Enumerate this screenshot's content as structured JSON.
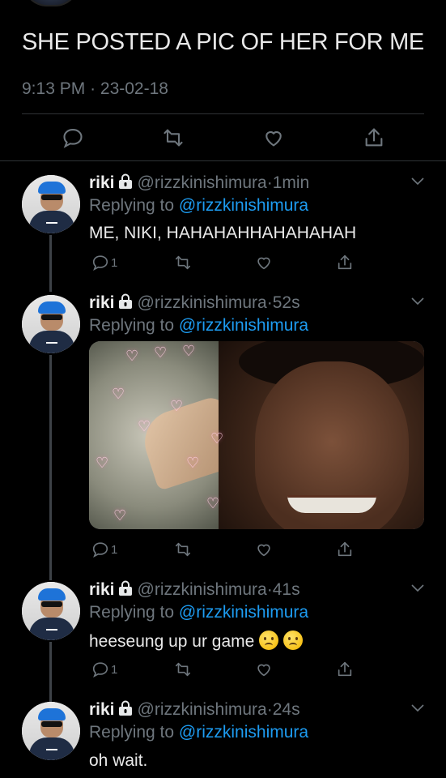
{
  "main_tweet": {
    "text": "SHE POSTED A PIC OF HER FOR ME",
    "time": "9:13 PM",
    "separator": "·",
    "date": "23-02-18"
  },
  "replies": [
    {
      "name": "riki",
      "handle": "@rizzkinishimura",
      "separator": "·",
      "time": "1min",
      "replying_prefix": "Replying to",
      "replying_to": "@rizzkinishimura",
      "text": "ME, NIKI, HAHAHAHHAHAHAHAH",
      "reply_count": "1"
    },
    {
      "name": "riki",
      "handle": "@rizzkinishimura",
      "separator": "·",
      "time": "52s",
      "replying_prefix": "Replying to",
      "replying_to": "@rizzkinishimura",
      "has_image": true,
      "reply_count": "1"
    },
    {
      "name": "riki",
      "handle": "@rizzkinishimura",
      "separator": "·",
      "time": "41s",
      "replying_prefix": "Replying to",
      "replying_to": "@rizzkinishimura",
      "text": "heeseung up ur game",
      "emojis": [
        "confused-face",
        "confused-face"
      ],
      "reply_count": "1"
    },
    {
      "name": "riki",
      "handle": "@rizzkinishimura",
      "separator": "·",
      "time": "24s",
      "replying_prefix": "Replying to",
      "replying_to": "@rizzkinishimura",
      "text": "oh wait."
    }
  ],
  "icons": [
    "reply-icon",
    "retweet-icon",
    "like-icon",
    "share-icon",
    "lock-icon",
    "chevron-down-icon"
  ],
  "colors": {
    "background": "#000000",
    "text": "#e7e9ea",
    "muted": "#6e767d",
    "link": "#1d9bf0",
    "divider": "#2f3336"
  }
}
